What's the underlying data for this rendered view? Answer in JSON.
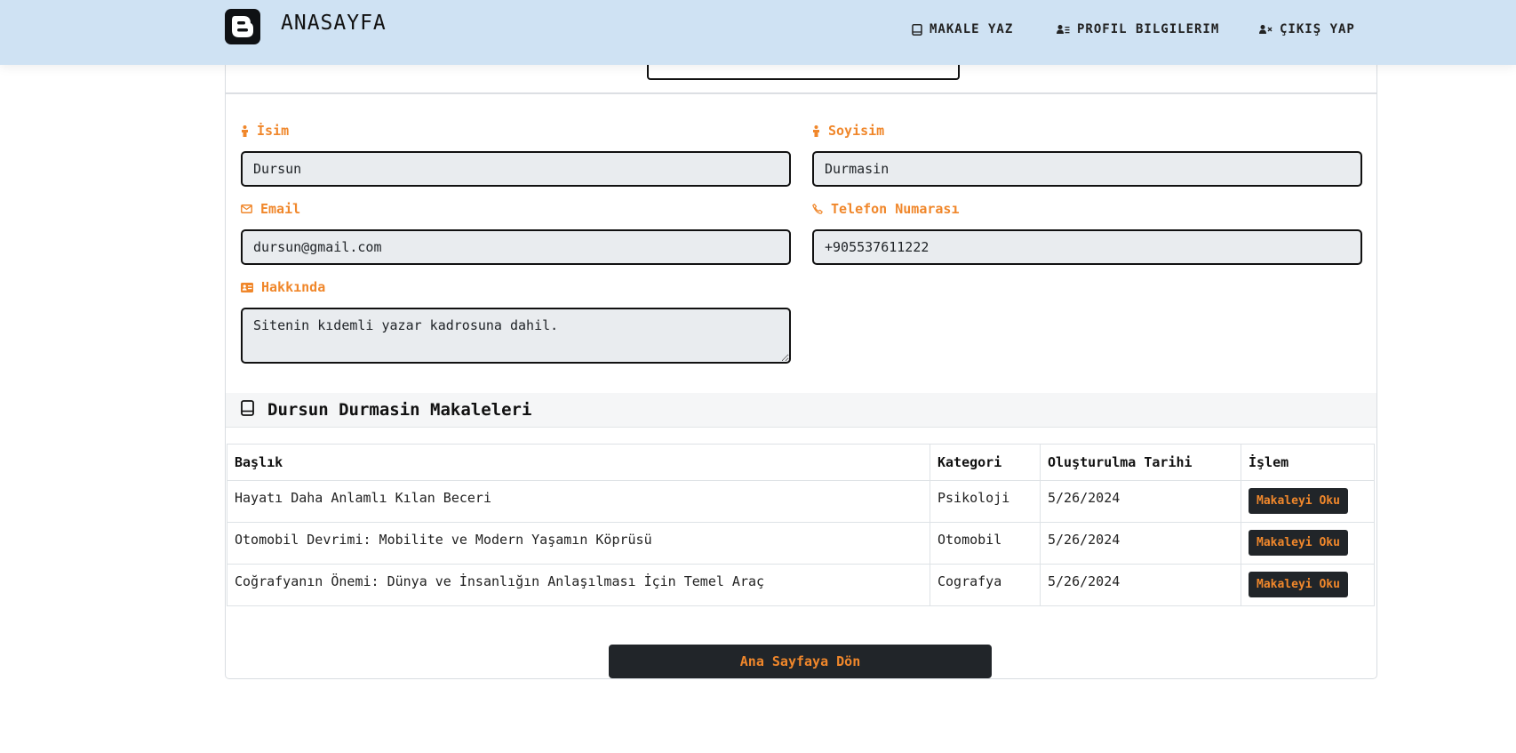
{
  "nav": {
    "brand": "ANASAYFA",
    "links": [
      {
        "label": "MAKALE YAZ",
        "icon": "book-icon"
      },
      {
        "label": "PROFIL BILGILERIM",
        "icon": "user-list-icon"
      },
      {
        "label": "ÇIKIŞ YAP",
        "icon": "user-x-icon"
      }
    ]
  },
  "profile": {
    "first_name": {
      "label": "İsim",
      "value": "Dursun"
    },
    "last_name": {
      "label": "Soyisim",
      "value": "Durmasin"
    },
    "email": {
      "label": "Email",
      "value": "dursun@gmail.com"
    },
    "phone": {
      "label": "Telefon Numarası",
      "value": "+905537611222"
    },
    "about": {
      "label": "Hakkında",
      "value": "Sitenin kıdemli yazar kadrosuna dahil."
    }
  },
  "articles": {
    "title": "Dursun Durmasin Makaleleri",
    "columns": [
      "Başlık",
      "Kategori",
      "Oluşturulma Tarihi",
      "İşlem"
    ],
    "rows": [
      {
        "title": "Hayatı Daha Anlamlı Kılan Beceri",
        "category": "Psikoloji",
        "date": "5/26/2024",
        "action": "Makaleyi Oku"
      },
      {
        "title": "Otomobil Devrimi: Mobilite ve Modern Yaşamın Köprüsü",
        "category": "Otomobil",
        "date": "5/26/2024",
        "action": "Makaleyi Oku"
      },
      {
        "title": "Coğrafyanın Önemi: Dünya ve İnsanlığın Anlaşılması İçin Temel Araç",
        "category": "Cografya",
        "date": "5/26/2024",
        "action": "Makaleyi Oku"
      }
    ]
  },
  "home_button": "Ana Sayfaya Dön",
  "colors": {
    "accent": "#f0872b",
    "navbar": "#cfe2f3",
    "dark": "#212529"
  }
}
